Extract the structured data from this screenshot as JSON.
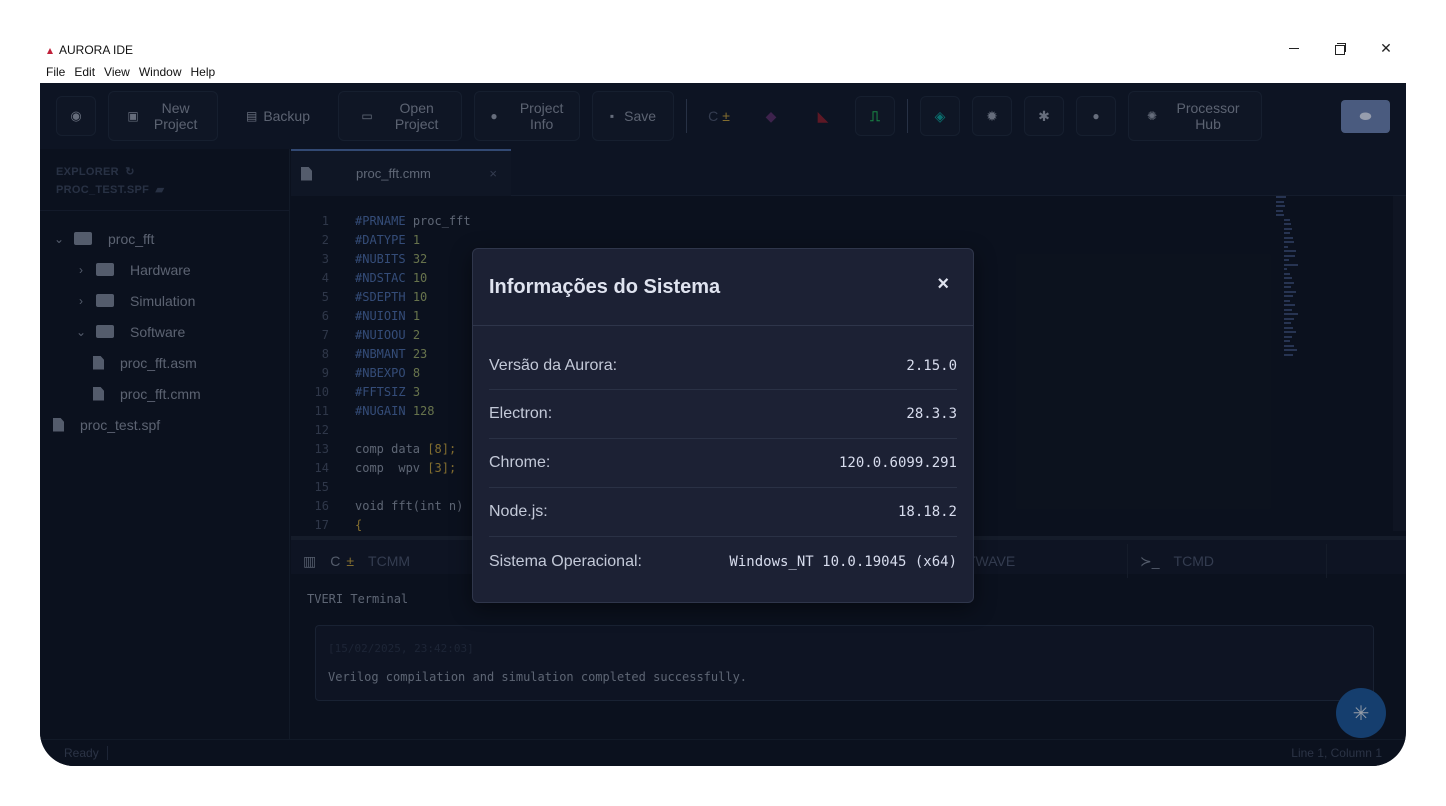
{
  "window": {
    "title": "AURORA IDE",
    "menu": [
      "File",
      "Edit",
      "View",
      "Window",
      "Help"
    ]
  },
  "toolbar": {
    "new_project": "New Project",
    "backup": "Backup",
    "open_project": "Open Project",
    "project_info": "Project Info",
    "save": "Save",
    "processor_hub": "Processor Hub",
    "cmm_label": "C",
    "colors": {
      "accent": "#4b6aa7",
      "robot": "#6f86b8",
      "wave": "#22c55e",
      "layers": "#0ea5a0"
    }
  },
  "sidebar": {
    "explorer_label": "EXPLORER",
    "project_label": "PROC_TEST.SPF",
    "tree": [
      {
        "label": "proc_fft",
        "type": "folder-open"
      },
      {
        "label": "Hardware",
        "type": "folder"
      },
      {
        "label": "Simulation",
        "type": "folder"
      },
      {
        "label": "Software",
        "type": "folder-open"
      },
      {
        "label": "proc_fft.asm",
        "type": "file"
      },
      {
        "label": "proc_fft.cmm",
        "type": "file"
      },
      {
        "label": "proc_test.spf",
        "type": "file"
      }
    ]
  },
  "editor": {
    "tab_name": "proc_fft.cmm",
    "tab_close": "×",
    "line_numbers": [
      "1",
      "2",
      "3",
      "4",
      "5",
      "6",
      "7",
      "8",
      "9",
      "10",
      "11",
      "12",
      "13",
      "14",
      "15",
      "16",
      "17"
    ],
    "lines": [
      {
        "k": "#PRNAME",
        "v": "proc_fft"
      },
      {
        "k": "#DATYPE",
        "v": "1"
      },
      {
        "k": "#NUBITS",
        "v": "32"
      },
      {
        "k": "#NDSTAC",
        "v": "10"
      },
      {
        "k": "#SDEPTH",
        "v": "10"
      },
      {
        "k": "#NUIOIN",
        "v": "1"
      },
      {
        "k": "#NUIOOU",
        "v": "2"
      },
      {
        "k": "#NBMANT",
        "v": "23"
      },
      {
        "k": "#NBEXPO",
        "v": "8"
      },
      {
        "k": "#FFTSIZ",
        "v": "3"
      },
      {
        "k": "#NUGAIN",
        "v": "128"
      },
      {
        "k": "",
        "v": ""
      },
      {
        "k": "comp data",
        "v": "[8];"
      },
      {
        "k": "comp  wpv",
        "v": "[3];"
      },
      {
        "k": "",
        "v": ""
      },
      {
        "k": "void fft(int n)",
        "v": ""
      },
      {
        "k": "{",
        "v": ""
      }
    ]
  },
  "panel": {
    "tabs": [
      "TCMM",
      "TWAVE",
      "TCMD"
    ],
    "terminal_title": "TVERI Terminal",
    "log_timestamp": "[15/02/2025, 23:42:03]",
    "log_message": "Verilog compilation and simulation completed successfully."
  },
  "statusbar": {
    "left": "Ready",
    "right": "Line 1, Column 1"
  },
  "dialog": {
    "title": "Informações do Sistema",
    "close": "×",
    "rows": [
      {
        "label": "Versão da Aurora:",
        "value": "2.15.0"
      },
      {
        "label": "Electron:",
        "value": "28.3.3"
      },
      {
        "label": "Chrome:",
        "value": "120.0.6099.291"
      },
      {
        "label": "Node.js:",
        "value": "18.18.2"
      },
      {
        "label": "Sistema Operacional:",
        "value": "Windows_NT 10.0.19045 (x64)"
      }
    ]
  }
}
